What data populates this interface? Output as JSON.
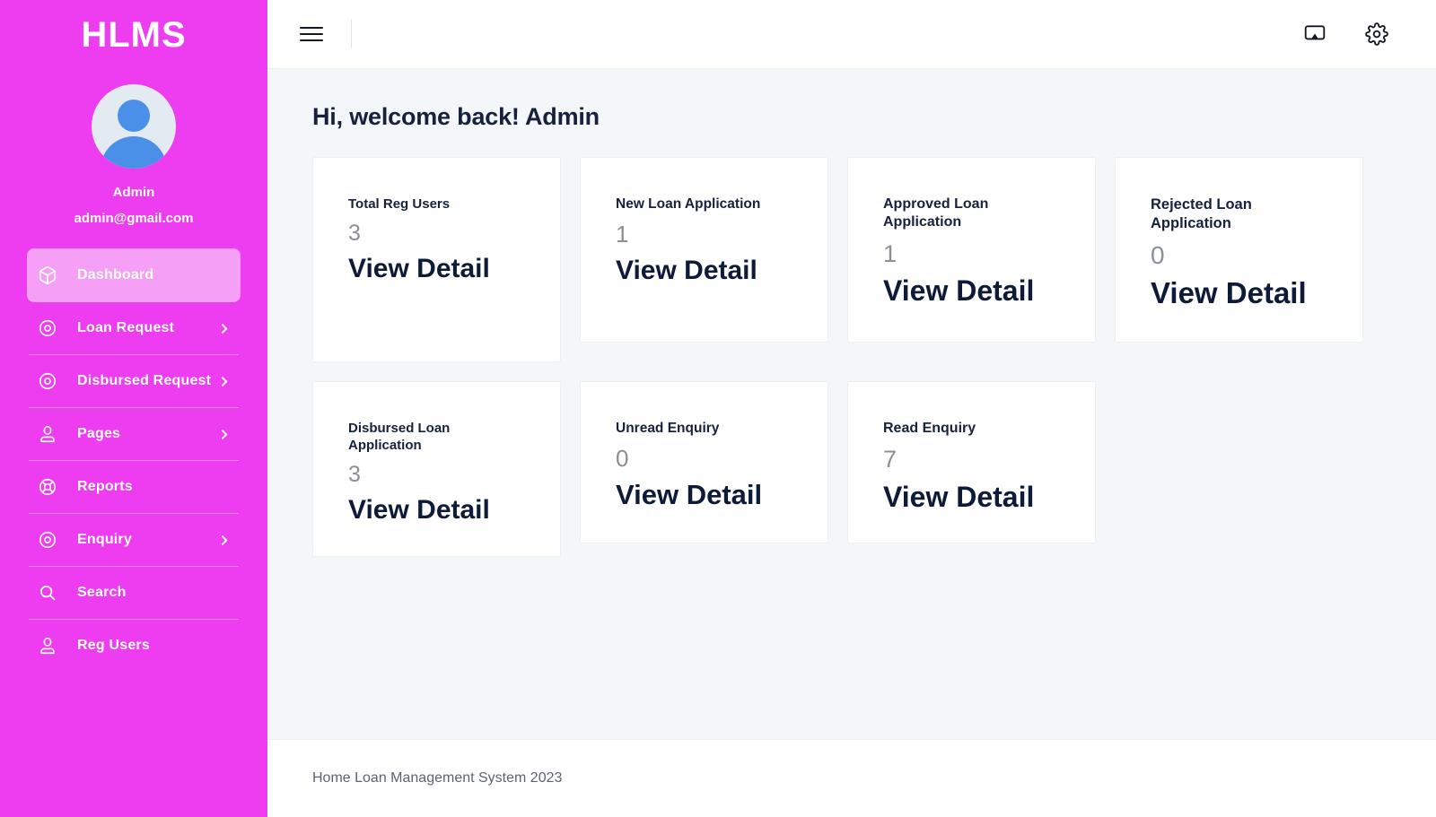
{
  "sidebar": {
    "brand": "HLMS",
    "profile": {
      "name": "Admin",
      "email": "admin@gmail.com",
      "avatar_icon": "user-avatar-icon"
    },
    "items": [
      {
        "label": "Dashboard",
        "icon": "box-icon",
        "active": true,
        "has_chevron": false
      },
      {
        "label": "Loan Request",
        "icon": "target-icon",
        "active": false,
        "has_chevron": true
      },
      {
        "label": "Disbursed Request",
        "icon": "target-icon",
        "active": false,
        "has_chevron": true
      },
      {
        "label": "Pages",
        "icon": "person-icon",
        "active": false,
        "has_chevron": true
      },
      {
        "label": "Reports",
        "icon": "lifebuoy-icon",
        "active": false,
        "has_chevron": false
      },
      {
        "label": "Enquiry",
        "icon": "target-icon",
        "active": false,
        "has_chevron": true
      },
      {
        "label": "Search",
        "icon": "search-icon",
        "active": false,
        "has_chevron": false
      },
      {
        "label": "Reg Users",
        "icon": "person-icon",
        "active": false,
        "has_chevron": false
      }
    ]
  },
  "topbar": {
    "menu_icon": "hamburger-icon",
    "cast_icon": "screen-cast-icon",
    "settings_icon": "gear-icon"
  },
  "main": {
    "greeting": "Hi, welcome back! Admin",
    "cards": [
      {
        "title": "Total Reg Users",
        "value": "3",
        "link": "View Detail"
      },
      {
        "title": "New Loan Application",
        "value": "1",
        "link": "View Detail"
      },
      {
        "title": "Approved Loan Application",
        "value": "1",
        "link": "View Detail"
      },
      {
        "title": "Rejected Loan Application",
        "value": "0",
        "link": "View Detail"
      },
      {
        "title": "Disbursed Loan Application",
        "value": "3",
        "link": "View Detail"
      },
      {
        "title": "Unread Enquiry",
        "value": "0",
        "link": "View Detail"
      },
      {
        "title": "Read Enquiry",
        "value": "7",
        "link": "View Detail"
      }
    ]
  },
  "footer": {
    "text": "Home Loan Management System 2023"
  },
  "colors": {
    "sidebar_bg": "#ee3cf0",
    "sidebar_active": "#f59ff7",
    "content_bg": "#f4f7f9",
    "card_bg": "#ffffff",
    "title_text": "#16213e",
    "link_text": "#0d1b38",
    "value_text": "#8b8f96",
    "avatar_accent": "#4a90e8"
  }
}
